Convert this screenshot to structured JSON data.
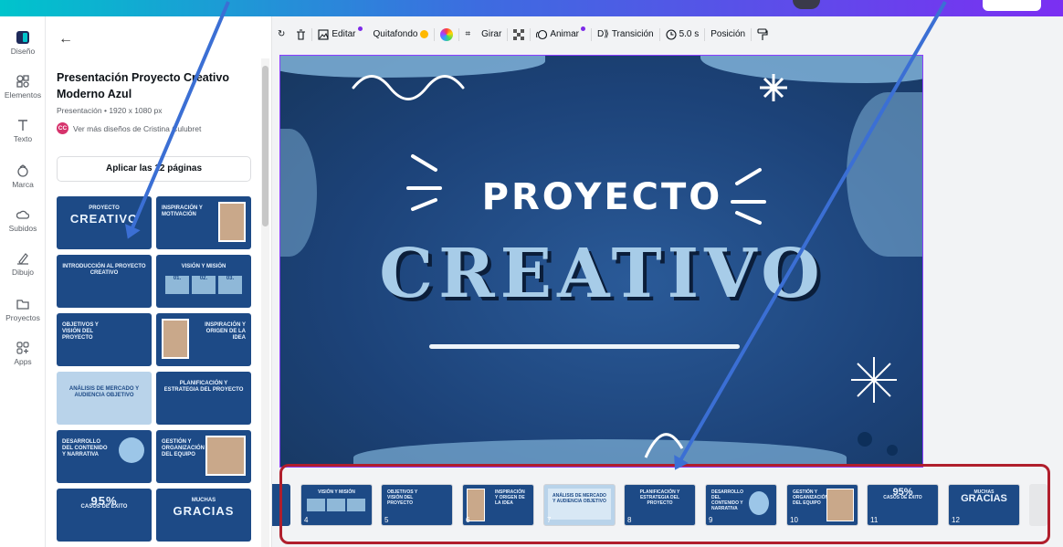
{
  "rail": {
    "items": [
      {
        "label": "Diseño",
        "icon": "design-icon"
      },
      {
        "label": "Elementos",
        "icon": "elements-icon"
      },
      {
        "label": "Texto",
        "icon": "text-icon"
      },
      {
        "label": "Marca",
        "icon": "brand-icon"
      },
      {
        "label": "Subidos",
        "icon": "upload-cloud-icon"
      },
      {
        "label": "Dibujo",
        "icon": "draw-pen-icon"
      },
      {
        "label": "Proyectos",
        "icon": "folder-icon"
      },
      {
        "label": "Apps",
        "icon": "apps-icon"
      }
    ]
  },
  "panel": {
    "back_icon": "←",
    "title": "Presentación Proyecto Creativo Moderno Azul",
    "meta": "Presentación • 1920 x 1080 px",
    "author_initials": "CC",
    "author_text": "Ver más diseños de Cristina Culubret",
    "apply_label": "Aplicar las 12 páginas",
    "templates": [
      {
        "text": "PROYECTO",
        "big": "CREATIVO"
      },
      {
        "text": "INSPIRACIÓN Y MOTIVACIÓN"
      },
      {
        "text": "INTRODUCCIÓN AL PROYECTO CREATIVO"
      },
      {
        "text": "VISIÓN Y MISIÓN",
        "boxes": [
          "01.",
          "02.",
          "03."
        ]
      },
      {
        "text": "OBJETIVOS Y VISIÓN DEL PROYECTO"
      },
      {
        "text": "INSPIRACIÓN Y ORIGEN DE LA IDEA"
      },
      {
        "text": "ANÁLISIS DE MERCADO Y AUDIENCIA OBJETIVO"
      },
      {
        "text": "PLANIFICACIÓN Y ESTRATEGIA DEL PROYECTO"
      },
      {
        "text": "DESARROLLO DEL CONTENIDO Y NARRATIVA"
      },
      {
        "text": "GESTIÓN Y ORGANIZACIÓN DEL EQUIPO"
      },
      {
        "text": "CASOS DE ÉXITO",
        "big": "95%"
      },
      {
        "text": "MUCHAS",
        "big": "GRACIAS"
      }
    ]
  },
  "toolbar": {
    "editar": "Editar",
    "quitafondo": "Quitafondo",
    "girar": "Girar",
    "animar": "Animar",
    "transicion": "Transición",
    "duration": "5.0 s",
    "posicion": "Posición"
  },
  "canvas": {
    "line1": "PROYECTO",
    "line2": "CREATIVO"
  },
  "filmstrip": {
    "slides": [
      {
        "num": "4",
        "text": "VISIÓN Y MISIÓN",
        "type": "boxes"
      },
      {
        "num": "5",
        "text": "OBJETIVOS Y VISIÓN DEL PROYECTO",
        "type": "list"
      },
      {
        "num": "6",
        "text": "INSPIRACIÓN Y ORIGEN DE LA IDEA",
        "type": "photo"
      },
      {
        "num": "7",
        "text": "ANÁLISIS DE MERCADO Y AUDIENCIA OBJETIVO",
        "type": "light"
      },
      {
        "num": "8",
        "text": "PLANIFICACIÓN Y ESTRATEGIA DEL PROYECTO",
        "type": "list"
      },
      {
        "num": "9",
        "text": "DESARROLLO DEL CONTENIDO Y NARRATIVA",
        "type": "circle"
      },
      {
        "num": "10",
        "text": "GESTIÓN Y ORGANIZACIÓN DEL EQUIPO",
        "type": "photo"
      },
      {
        "num": "11",
        "text": "CASOS DE ÉXITO",
        "big": "95%",
        "type": "big"
      },
      {
        "num": "12",
        "text": "MUCHAS",
        "big": "GRACIAS",
        "type": "big"
      }
    ]
  },
  "colors": {
    "slide_blue": "#1d4a86",
    "annotation_arrow": "#3b6fd4",
    "highlight_box": "#b01e2c",
    "selection_purple": "#8b3dff"
  }
}
